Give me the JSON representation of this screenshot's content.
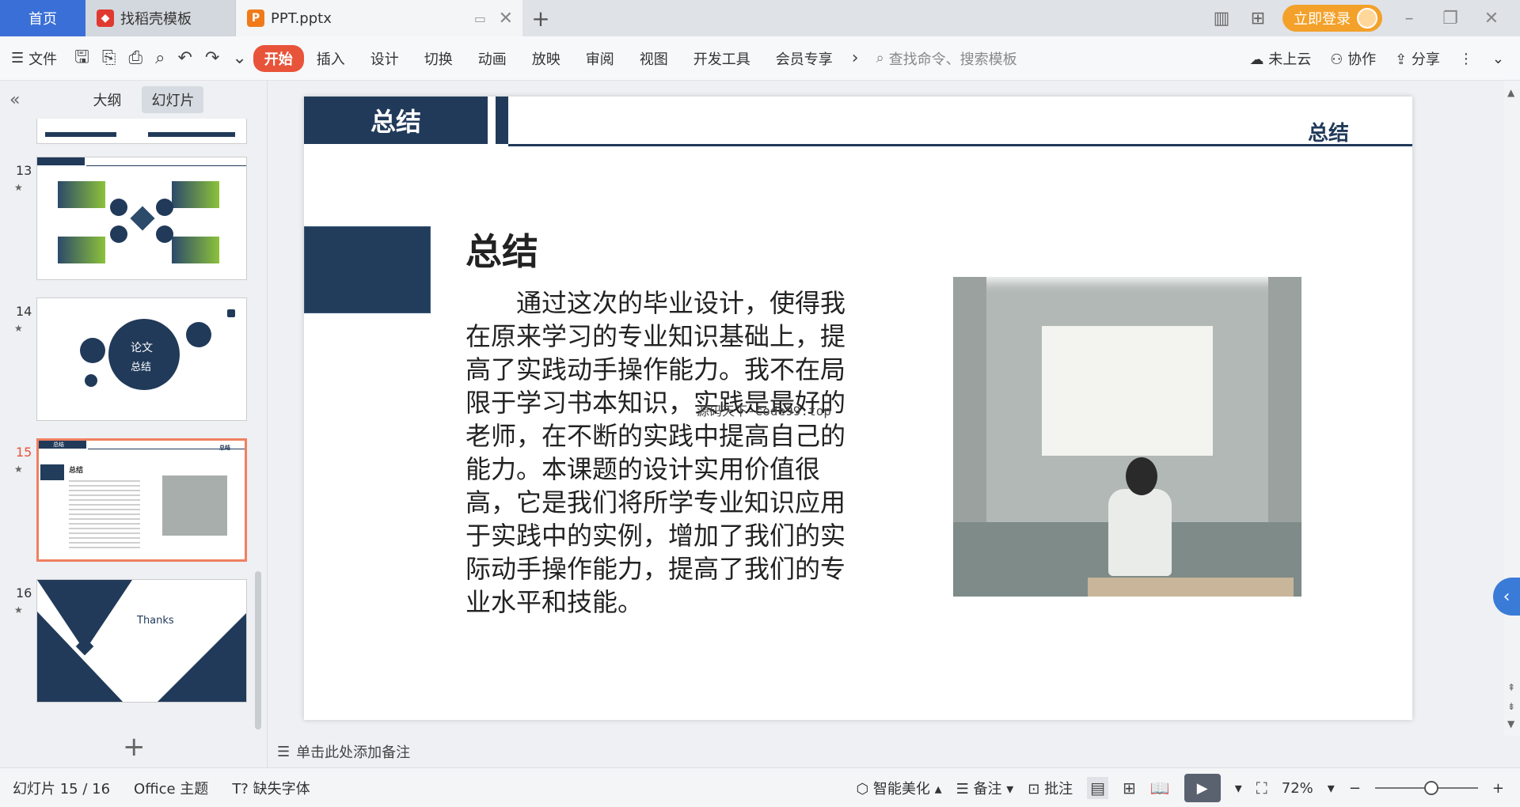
{
  "tabbar": {
    "home": "首页",
    "tab1": "找稻壳模板",
    "tab2": "PPT.pptx",
    "login": "立即登录"
  },
  "ribbon": {
    "file": "文件",
    "tabs": [
      "开始",
      "插入",
      "设计",
      "切换",
      "动画",
      "放映",
      "审阅",
      "视图",
      "开发工具",
      "会员专享"
    ],
    "search_placeholder": "查找命令、搜索模板",
    "cloud": "未上云",
    "collab": "协作",
    "share": "分享"
  },
  "leftpanel": {
    "tab_outline": "大纲",
    "tab_slides": "幻灯片",
    "thumbs": [
      {
        "num": "13"
      },
      {
        "num": "14",
        "title_line1": "论文",
        "title_line2": "总结"
      },
      {
        "num": "15",
        "hdr_left": "总结",
        "hdr_right": "总结",
        "title": "总结"
      },
      {
        "num": "16",
        "title": "Thanks"
      }
    ]
  },
  "slide": {
    "header_left": "总结",
    "header_right": "总结",
    "title": "总结",
    "body": "通过这次的毕业设计，使得我在原来学习的专业知识基础上，提高了实践动手操作能力。我不在局限于学习书本知识，实践是最好的老师，在不断的实践中提高自己的能力。本课题的设计实用价值很高，它是我们将所学专业知识应用于实践中的实例，增加了我们的实际动手操作能力，提高了我们的专业水平和技能。",
    "watermark": "源码天下-code99.top"
  },
  "notes": {
    "placeholder": "单击此处添加备注"
  },
  "status": {
    "slide_count": "幻灯片 15 / 16",
    "theme": "Office 主题",
    "missing_font": "缺失字体",
    "beautify": "智能美化",
    "notes": "备注",
    "comment": "批注",
    "zoom": "72%",
    "zoom_fraction": 0.55
  }
}
